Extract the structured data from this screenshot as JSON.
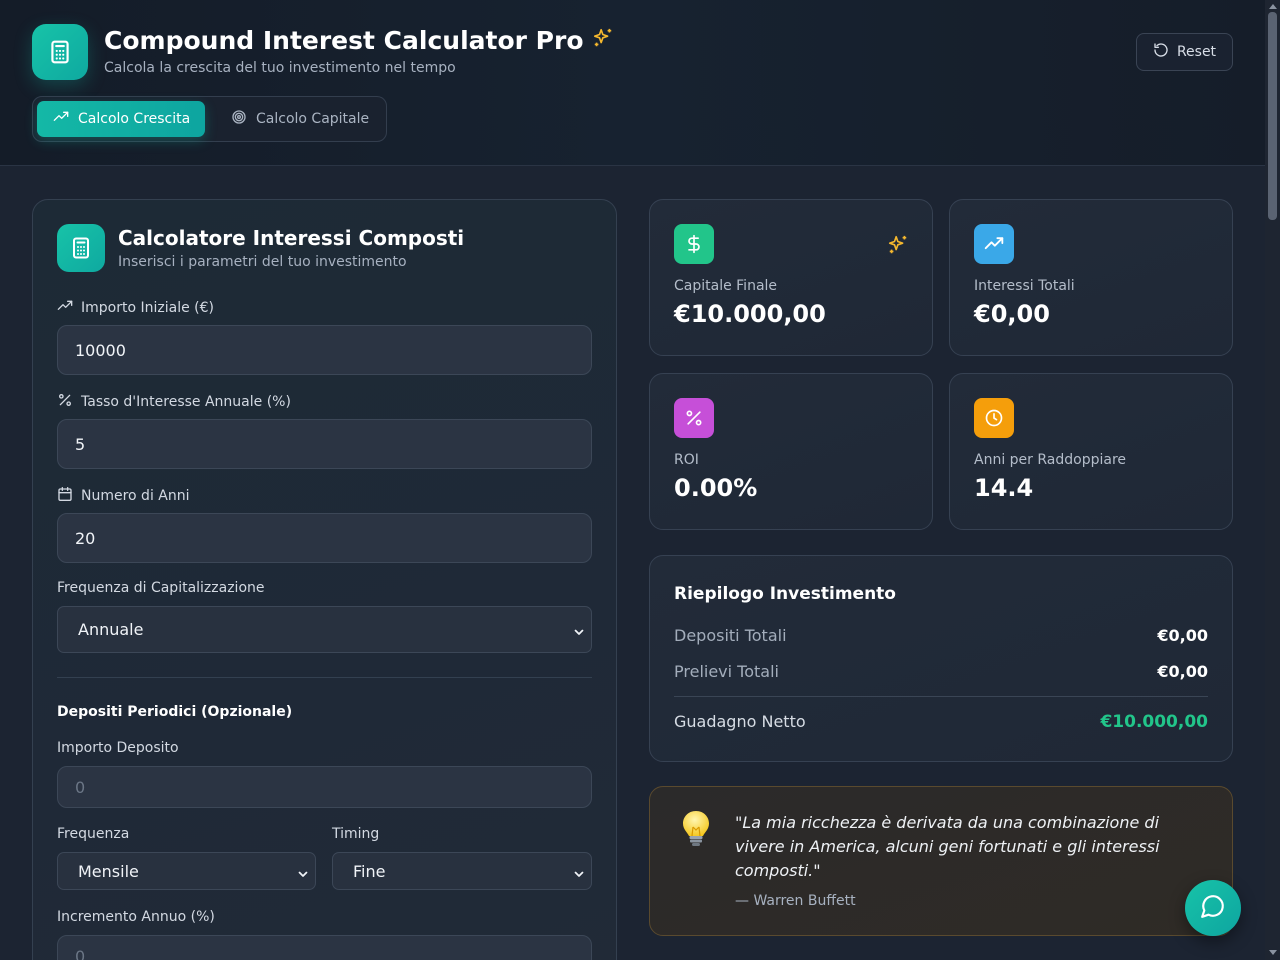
{
  "header": {
    "title": "Compound Interest Calculator Pro",
    "subtitle": "Calcola la crescita del tuo investimento nel tempo",
    "reset_label": "Reset",
    "tabs": [
      {
        "label": "Calcolo Crescita",
        "active": true
      },
      {
        "label": "Calcolo Capitale",
        "active": false
      }
    ]
  },
  "form": {
    "title": "Calcolatore Interessi Composti",
    "subtitle": "Inserisci i parametri del tuo investimento",
    "initial_amount": {
      "label": "Importo Iniziale (€)",
      "value": "10000"
    },
    "interest_rate": {
      "label": "Tasso d'Interesse Annuale (%)",
      "value": "5"
    },
    "years": {
      "label": "Numero di Anni",
      "value": "20"
    },
    "compounding": {
      "label": "Frequenza di Capitalizzazione",
      "value": "Annuale"
    },
    "periodic_section_title": "Depositi Periodici (Opzionale)",
    "deposit_amount": {
      "label": "Importo Deposito",
      "placeholder": "0"
    },
    "frequency": {
      "label": "Frequenza",
      "value": "Mensile"
    },
    "timing": {
      "label": "Timing",
      "value": "Fine"
    },
    "annual_increase": {
      "label": "Incremento Annuo (%)",
      "placeholder": "0"
    }
  },
  "stats": {
    "final_capital": {
      "label": "Capitale Finale",
      "value": "€10.000,00"
    },
    "total_interest": {
      "label": "Interessi Totali",
      "value": "€0,00"
    },
    "roi": {
      "label": "ROI",
      "value": "0.00%"
    },
    "doubling_years": {
      "label": "Anni per Raddoppiare",
      "value": "14.4"
    }
  },
  "summary": {
    "title": "Riepilogo Investimento",
    "total_deposits": {
      "label": "Depositi Totali",
      "value": "€0,00"
    },
    "total_withdrawals": {
      "label": "Prelievi Totali",
      "value": "€0,00"
    },
    "net_gain": {
      "label": "Guadagno Netto",
      "value": "€10.000,00"
    }
  },
  "quote": {
    "text": "\"La mia ricchezza è derivata da una combinazione di vivere in America, alcuni geni fortunati e gli interessi composti.\"",
    "author": "— Warren Buffett"
  },
  "colors": {
    "accent": "#14b8a6",
    "money_icon": "#22c58a",
    "trend_icon": "#3aa8e8",
    "percent_icon": "#c64fd8",
    "clock_icon": "#f59e0b",
    "net_gain": "#22c58a",
    "sparkle": "#f5b82e"
  },
  "icons": {
    "logo": "calculator-icon",
    "title_decoration": "sparkles-icon",
    "reset": "rotate-ccw-icon",
    "tab_growth": "trending-up-icon",
    "tab_capital": "target-icon",
    "chat": "message-circle-icon"
  }
}
